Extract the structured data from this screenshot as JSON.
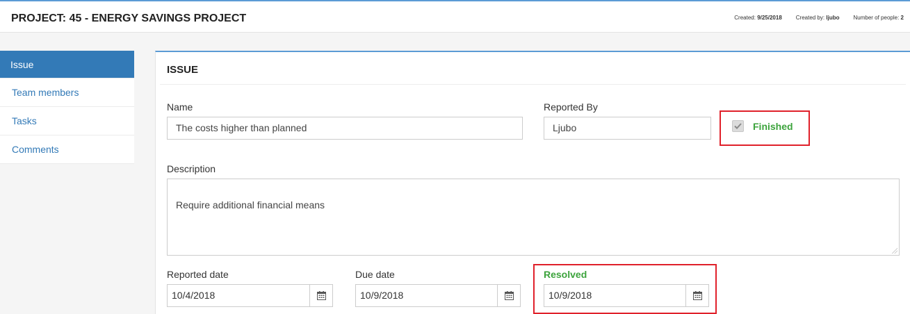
{
  "header": {
    "title": "PROJECT: 45 - ENERGY SAVINGS PROJECT",
    "created_label": "Created:",
    "created_value": "9/25/2018",
    "created_by_label": "Created by:",
    "created_by_value": "ljubo",
    "people_label": "Number of people:",
    "people_value": "2"
  },
  "sidebar": {
    "items": [
      {
        "label": "Issue"
      },
      {
        "label": "Team members"
      },
      {
        "label": "Tasks"
      },
      {
        "label": "Comments"
      }
    ]
  },
  "issue": {
    "title": "ISSUE",
    "name_label": "Name",
    "name_value": "The costs higher than planned",
    "reported_by_label": "Reported By",
    "reported_by_value": "Ljubo",
    "finished_label": "Finished",
    "description_label": "Description",
    "description_value": "Require additional financial means",
    "reported_date_label": "Reported date",
    "reported_date_value": "10/4/2018",
    "due_date_label": "Due date",
    "due_date_value": "10/9/2018",
    "resolved_label": "Resolved",
    "resolved_value": "10/9/2018"
  },
  "colors": {
    "accent": "#337ab7",
    "success_green": "#3ca33c",
    "highlight_red": "#e0202a"
  },
  "icons": [
    "calendar-icon",
    "checkmark-icon"
  ]
}
